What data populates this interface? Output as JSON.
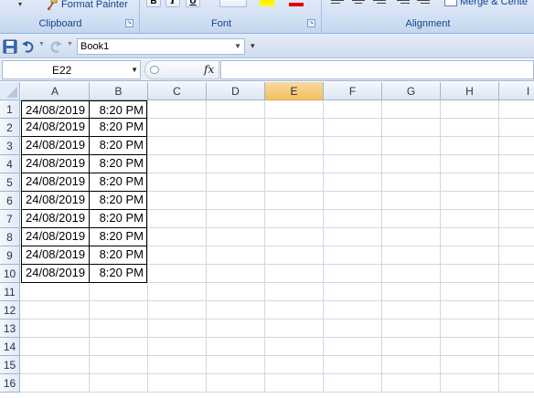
{
  "ribbon": {
    "clipboard": {
      "format_painter_label": "Format Painter",
      "group_label": "Clipboard"
    },
    "font": {
      "bold_label": "B",
      "italic_label": "I",
      "underline_label": "U",
      "group_label": "Font",
      "fill_color": "#ffff00",
      "font_color": "#e30000"
    },
    "alignment": {
      "merge_label": "Merge & Cente",
      "group_label": "Alignment"
    }
  },
  "qat": {
    "document_name": "Book1",
    "icons": [
      "save-icon",
      "undo-icon",
      "redo-icon"
    ]
  },
  "formula_bar": {
    "name_box": "E22",
    "fx_label": "fx",
    "formula": ""
  },
  "grid": {
    "columns": [
      "A",
      "B",
      "C",
      "D",
      "E",
      "F",
      "G",
      "H",
      "I"
    ],
    "selected_column": "E",
    "selected_color": "#f6c86a",
    "rows": [
      "1",
      "2",
      "3",
      "4",
      "5",
      "6",
      "7",
      "8",
      "9",
      "10",
      "11",
      "12",
      "13",
      "14",
      "15",
      "16"
    ],
    "cells": [
      {
        "a": "24/08/2019",
        "b": "8:20 PM"
      },
      {
        "a": "24/08/2019",
        "b": "8:20 PM"
      },
      {
        "a": "24/08/2019",
        "b": "8:20 PM"
      },
      {
        "a": "24/08/2019",
        "b": "8:20 PM"
      },
      {
        "a": "24/08/2019",
        "b": "8:20 PM"
      },
      {
        "a": "24/08/2019",
        "b": "8:20 PM"
      },
      {
        "a": "24/08/2019",
        "b": "8:20 PM"
      },
      {
        "a": "24/08/2019",
        "b": "8:20 PM"
      },
      {
        "a": "24/08/2019",
        "b": "8:20 PM"
      },
      {
        "a": "24/08/2019",
        "b": "8:20 PM"
      }
    ]
  }
}
